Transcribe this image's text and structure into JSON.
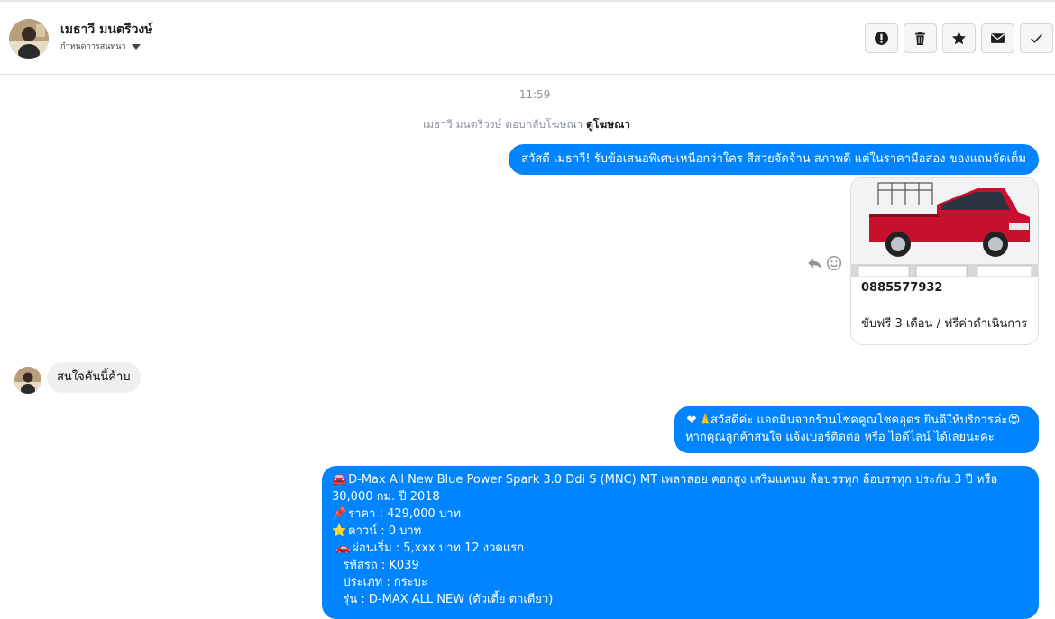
{
  "header": {
    "name": "เมธาวี มนตรีวงษ์",
    "subtitle": "กำหนดการสนทนา",
    "actions": [
      "report",
      "delete",
      "star",
      "mark-unread",
      "done"
    ]
  },
  "thread": {
    "time": "11:59",
    "reply_note": "เมธาวี มนตรีวงษ์ ตอบกลับโฆษณา",
    "reply_link": "ดูโฆษณา",
    "outgoing_1": "สวัสดี เมธาวี! รับข้อเสนอพิเศษเหนือกว่าใคร สีสวยจัดจ้าน สภาพดี แต่ในราคามือสอง ของแถมจัดเต็ม",
    "card": {
      "phone": "0885577932",
      "description": "ขับฟรี 3 เดือน / ฟรีค่าดำเนินการ",
      "car_color": "#c8102e"
    },
    "incoming_1": "สนใจคันนี้ค้าบ",
    "outgoing_2": {
      "line1": "สวัสดีค่ะ แอดมินจากร้านโชคคูณโชคอุดร ยินดีให้บริการค่ะ",
      "line2": "หากคุณลูกค้าสนใจ แจ้งเบอร์ติดต่อ หรือ ไอดีไลน์ ได้เลยนะคะ"
    },
    "outgoing_3": {
      "title_line1": "D-Max All New Blue Power Spark 3.0 Ddi S (MNC) MT เพลาลอย คอกสูง เสริมแหนบ ล้อบรรทุก ล้อบรรทุก ประกัน 3 ปี หรือ",
      "title_line2": "30,000 กม. ปี 2018",
      "price": "ราคา : 429,000 บาท",
      "down": "ดาวน์ : 0 บาท",
      "installment": "ผ่อนเริ่ม : 5,xxx บาท 12 งวดแรก",
      "code": "รหัสรถ : K039",
      "type": "ประเภท : กระบะ",
      "model": "รุ่น : D-MAX ALL NEW (ตัวเตี้ย ตาเดียว)"
    }
  },
  "colors": {
    "accent": "#0084ff",
    "incoming_bubble": "#f1f0f0",
    "meta_text": "#8d949e"
  }
}
